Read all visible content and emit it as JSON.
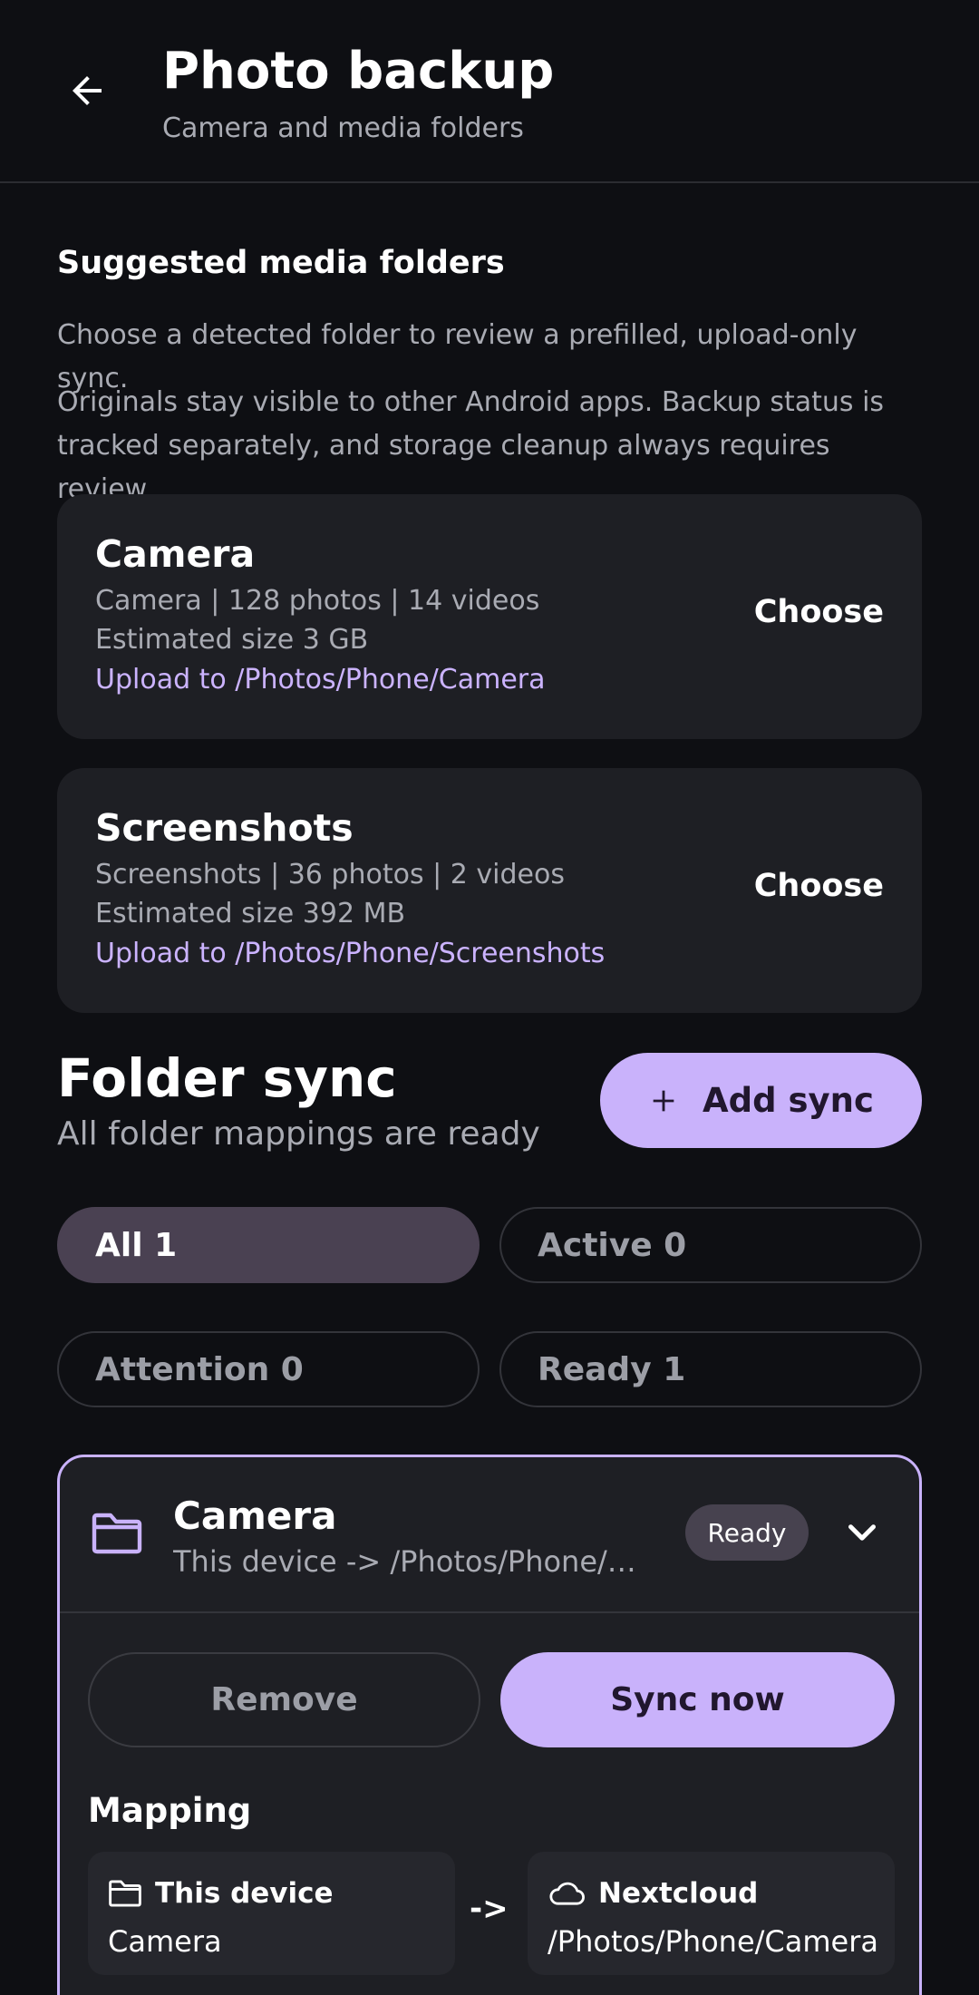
{
  "header": {
    "title": "Photo backup",
    "subtitle": "Camera and media folders"
  },
  "suggested": {
    "heading": "Suggested media folders",
    "description": "Choose a detected folder to review a prefilled, upload-only sync.",
    "note": "Originals stay visible to other Android apps. Backup status is tracked separately, and storage cleanup always requires review.",
    "items": [
      {
        "name": "Camera",
        "counts": "Camera | 128 photos | 14 videos",
        "size": "Estimated size 3 GB",
        "target": "Upload to /Photos/Phone/Camera",
        "action": "Choose"
      },
      {
        "name": "Screenshots",
        "counts": "Screenshots | 36 photos | 2 videos",
        "size": "Estimated size 392 MB",
        "target": "Upload to /Photos/Phone/Screenshots",
        "action": "Choose"
      }
    ]
  },
  "folder_sync": {
    "title": "Folder sync",
    "subtitle": "All folder mappings are ready",
    "add_label": "Add sync",
    "filters": [
      {
        "label": "All 1",
        "selected": true
      },
      {
        "label": "Active 0",
        "selected": false
      },
      {
        "label": "Attention 0",
        "selected": false
      },
      {
        "label": "Ready 1",
        "selected": false
      }
    ]
  },
  "sync_card": {
    "name": "Camera",
    "path": "This device -> /Photos/Phone/Camera",
    "status": "Ready",
    "remove_label": "Remove",
    "sync_label": "Sync now",
    "mapping_title": "Mapping",
    "source_label": "This device",
    "source_value": "Camera",
    "arrow": "->",
    "dest_label": "Nextcloud",
    "dest_value": "/Photos/Phone/Camera"
  },
  "colors": {
    "background": "#0e0f13",
    "card": "#1e1f24",
    "accent": "#c9b2fb",
    "link": "#cbb3ff",
    "muted_text": "#a9abb3"
  }
}
